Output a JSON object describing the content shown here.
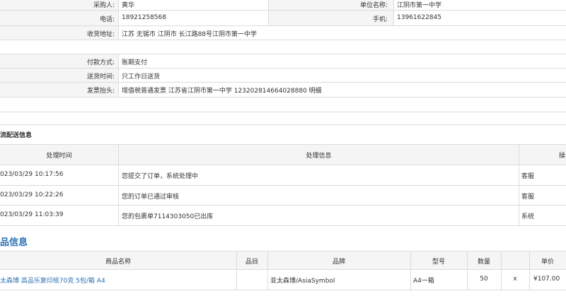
{
  "buyer": {
    "purchaser_label": "采购人:",
    "purchaser_value": "黄华",
    "unit_label": "单位名称:",
    "unit_value": "江阴市第一中学",
    "phone_label": "电话:",
    "phone_value": "18921258568",
    "mobile_label": "手机:",
    "mobile_value": "13961622845",
    "address_label": "收货地址:",
    "address_value": "江苏 无锡市 江阴市 长江路88号江阴市第一中学"
  },
  "payment": {
    "method_label": "付款方式:",
    "method_value": "账期支付",
    "delivery_label": "送货时间:",
    "delivery_value": "只工作日送货",
    "invoice_label": "发票抬头:",
    "invoice_value": "增值税普通发票 江苏省江阴市第一中学 123202814664028880 明细"
  },
  "logistics": {
    "title": "流配送信息",
    "headers": {
      "time": "处理时间",
      "info": "处理信息",
      "operator": "操"
    },
    "rows": [
      {
        "time": "023/03/29 10:17:56",
        "info": "您提交了订单，系统处理中",
        "operator": "客服"
      },
      {
        "time": "023/03/29 10:22:26",
        "info": "您的订单已通过审核",
        "operator": "客服"
      },
      {
        "time": "023/03/29 11:03:39",
        "info": "您的包裹单7114303050已出库",
        "operator": "系统"
      }
    ]
  },
  "products": {
    "title": "品信息",
    "headers": {
      "name": "商品名称",
      "item": "品目",
      "brand": "品牌",
      "model": "型号",
      "qty": "数量",
      "price": "单价"
    },
    "rows": [
      {
        "name": "太森博 高品乐复印纸70克 5包/箱 A4",
        "item": "",
        "brand": "亚太森博/AsiaSymbol",
        "model": "A4一箱",
        "qty": "50",
        "mult": "x",
        "price": "¥107.00"
      }
    ]
  }
}
